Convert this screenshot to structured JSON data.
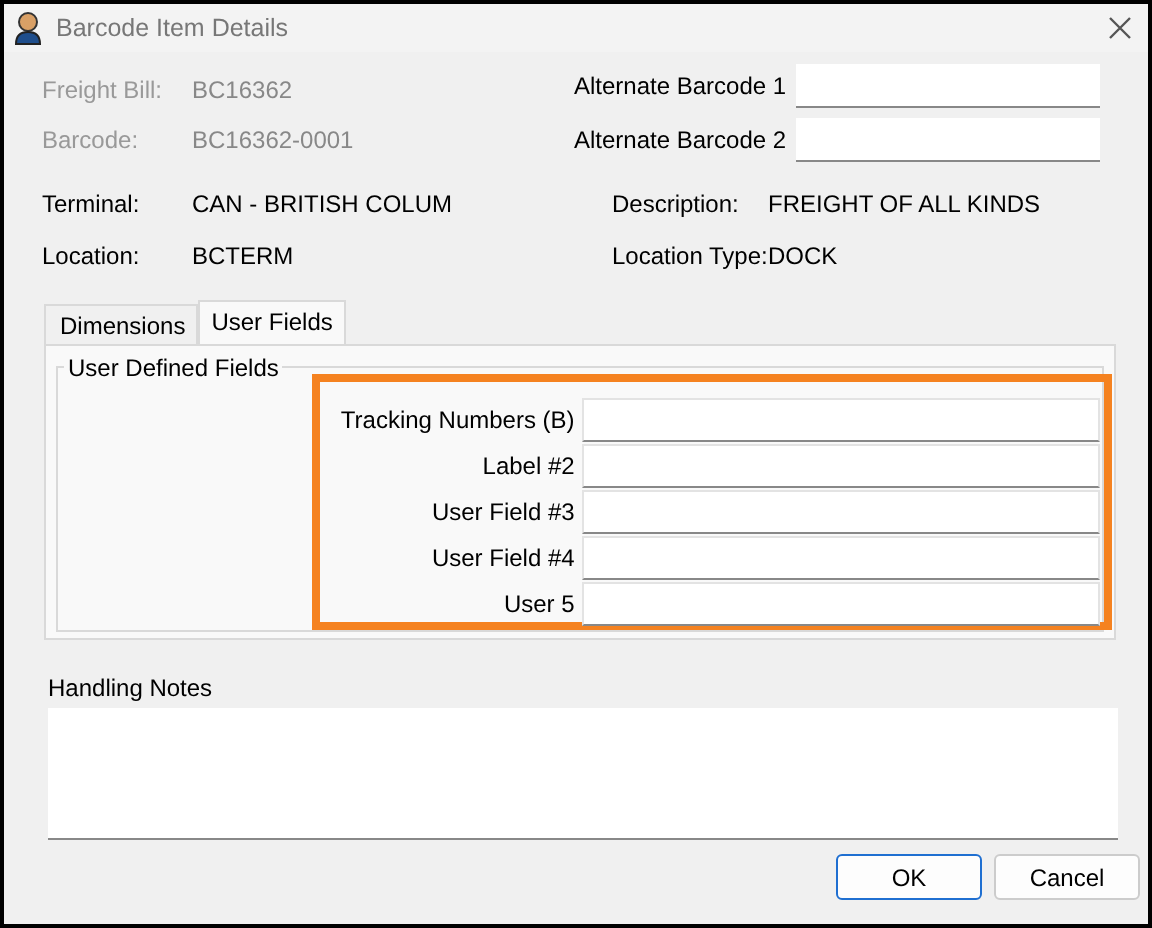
{
  "window": {
    "title": "Barcode Item Details"
  },
  "header_fields": [
    {
      "label": "Freight Bill:",
      "value": "BC16362",
      "disabled": true
    },
    {
      "label": "Barcode:",
      "value": "BC16362-0001",
      "disabled": true
    }
  ],
  "alternate_barcodes": [
    {
      "label": "Alternate Barcode 1"
    },
    {
      "label": "Alternate Barcode 2"
    }
  ],
  "info": [
    {
      "label": "Terminal:",
      "value": "CAN - BRITISH COLUM"
    },
    {
      "label": "Description:",
      "value": "FREIGHT OF ALL KINDS"
    },
    {
      "label": "Location:",
      "value": "BCTERM"
    },
    {
      "label": "Location Type:",
      "value": "DOCK"
    }
  ],
  "tabs": [
    {
      "label": "Dimensions",
      "selected": false
    },
    {
      "label": "User Fields",
      "selected": true
    }
  ],
  "group": {
    "title": "User Defined Fields",
    "highlighted": true
  },
  "user_fields": [
    {
      "label": "Tracking Numbers (B)"
    },
    {
      "label": "Label #2"
    },
    {
      "label": "User Field #3"
    },
    {
      "label": "User Field #4"
    },
    {
      "label": "User 5"
    }
  ],
  "handling_notes": {
    "label": "Handling Notes"
  },
  "buttons": [
    {
      "label": "OK",
      "default": true
    },
    {
      "label": "Cancel",
      "default": false
    }
  ]
}
